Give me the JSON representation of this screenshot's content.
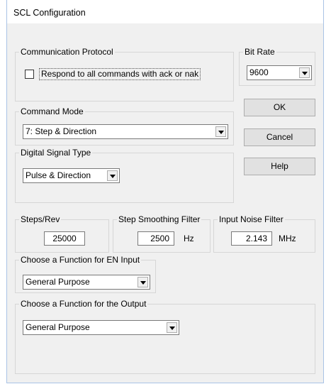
{
  "window": {
    "title": "SCL Configuration"
  },
  "communication_protocol": {
    "legend": "Communication Protocol",
    "checkbox_label": "Respond to all commands with ack or nak",
    "checked": false
  },
  "bit_rate": {
    "legend": "Bit Rate",
    "value": "9600"
  },
  "command_mode": {
    "legend": "Command Mode",
    "value": "7: Step & Direction"
  },
  "digital_signal_type": {
    "legend": "Digital Signal Type",
    "value": "Pulse & Direction"
  },
  "buttons": {
    "ok": "OK",
    "cancel": "Cancel",
    "help": "Help"
  },
  "steps_rev": {
    "legend": "Steps/Rev",
    "value": "25000"
  },
  "step_smoothing": {
    "legend": "Step Smoothing Filter",
    "value": "2500",
    "unit": "Hz"
  },
  "input_noise": {
    "legend": "Input Noise Filter",
    "value": "2.143",
    "unit": "MHz"
  },
  "en_input": {
    "legend": "Choose a Function for EN Input",
    "value": "General Purpose"
  },
  "output_function": {
    "legend": "Choose a Function for the Output",
    "value": "General Purpose"
  }
}
